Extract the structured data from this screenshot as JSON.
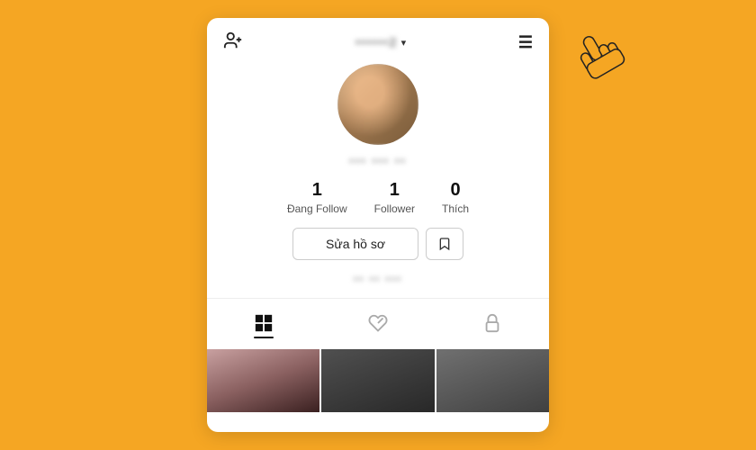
{
  "background_color": "#F5A623",
  "header": {
    "add_user_icon": "👤+",
    "username": "••••••2",
    "chevron": "∨",
    "menu_icon": "☰"
  },
  "profile": {
    "avatar_alt": "profile picture",
    "name_blurred": "••• ••• ••",
    "stats": [
      {
        "number": "1",
        "label": "Đang Follow"
      },
      {
        "number": "1",
        "label": "Follower"
      },
      {
        "number": "0",
        "label": "Thích"
      }
    ],
    "edit_button_label": "Sửa hồ sơ",
    "bio_blurred": "•• •• •••"
  },
  "tabs": [
    {
      "id": "grid",
      "label": "grid",
      "active": true
    },
    {
      "id": "liked",
      "label": "liked",
      "active": false
    },
    {
      "id": "private",
      "label": "private",
      "active": false
    }
  ]
}
